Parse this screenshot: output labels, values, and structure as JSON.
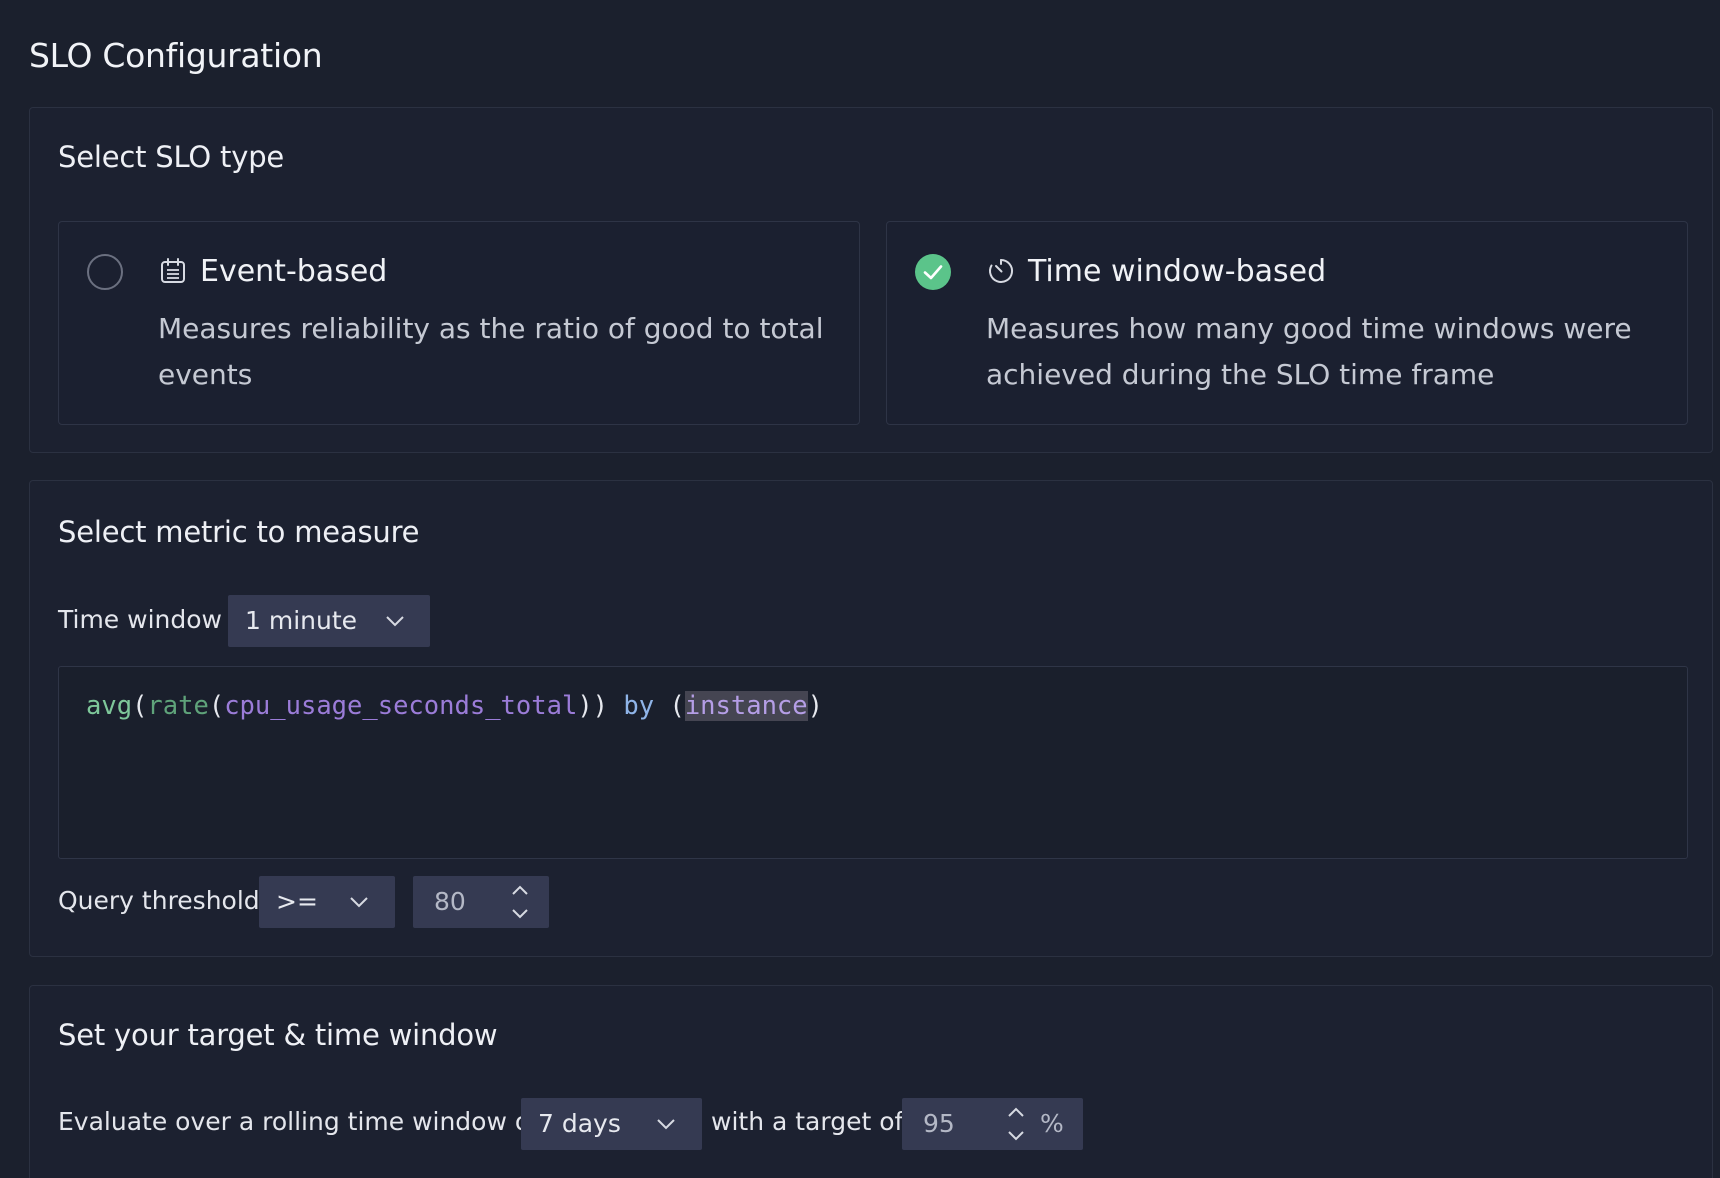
{
  "page": {
    "title": "SLO Configuration"
  },
  "slo_type": {
    "title": "Select SLO type",
    "options": [
      {
        "name": "Event-based",
        "description": "Measures reliability as the ratio of good to total events",
        "icon": "calendar-list-icon",
        "selected": false
      },
      {
        "name": "Time window-based",
        "description": "Measures how many good time windows were achieved during the SLO time frame",
        "icon": "timer-icon",
        "selected": true
      }
    ]
  },
  "metric": {
    "title": "Select metric to measure",
    "time_window_label": "Time window",
    "time_window_value": "1 minute",
    "query": {
      "fn": "avg",
      "inner_fn": "rate",
      "metric": "cpu_usage_seconds_total",
      "keyword": "by",
      "label": "instance"
    },
    "threshold_label": "Query threshold",
    "threshold_operator": ">=",
    "threshold_value": "80"
  },
  "target": {
    "title": "Set your target & time window",
    "prefix": "Evaluate over a rolling time window of",
    "window_value": "7 days",
    "middle": "with a target of",
    "target_value": "95",
    "unit": "%"
  },
  "colors": {
    "success": "#5bc48a",
    "background": "#1b202d",
    "input_bg": "#353a52"
  }
}
